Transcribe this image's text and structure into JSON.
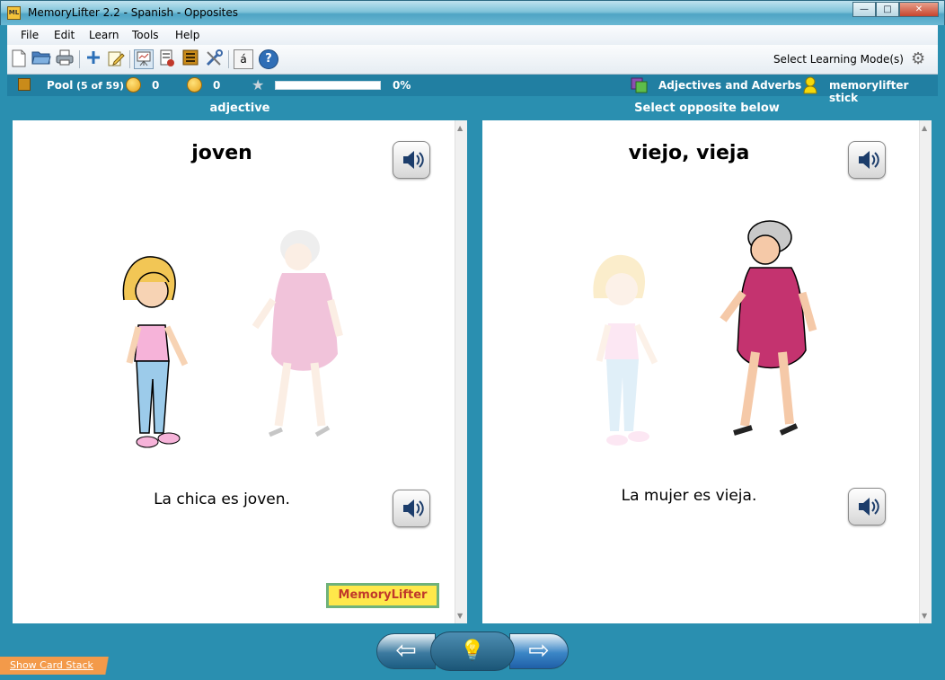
{
  "window": {
    "app_icon_text": "ML",
    "title": "MemoryLifter 2.2 - Spanish - Opposites",
    "minimize": "—",
    "maximize": "□",
    "close": "✕"
  },
  "menu": [
    "File",
    "Edit",
    "Learn",
    "Tools",
    "Help"
  ],
  "toolbar": {
    "icons": [
      "new-icon",
      "open-icon",
      "print-icon",
      "add-card-icon",
      "edit-icon",
      "presentation-icon",
      "card-stack-icon",
      "card-list-icon",
      "tools-icon",
      "accent-character-icon",
      "help-icon"
    ],
    "accent_glyph": "á",
    "help_glyph": "?",
    "mode_label": "Select Learning Mode(s)"
  },
  "status": {
    "pool_label": "Pool",
    "pool_count": "(5 of 59)",
    "correct_count": "0",
    "wrong_count": "0",
    "progress_percent": 0,
    "progress_text": "0%",
    "chapter": "Adjectives and Adverbs",
    "user": "memorylifter stick"
  },
  "question_panel": {
    "header": "adjective",
    "word": "joven",
    "sentence": "La chica es joven.",
    "logo_text": "MemoryLifter"
  },
  "answer_panel": {
    "header": "Select opposite below",
    "word": "viejo, vieja",
    "sentence": "La mujer es vieja."
  },
  "navigation": {
    "prev_glyph": "⇦",
    "hint_glyph": "💡",
    "next_glyph": "⇨"
  },
  "show_card_stack": "Show Card Stack",
  "colors": {
    "accent": "#217fa2",
    "window_bg": "#2a8fb0",
    "logo_yellow": "#ffe84a",
    "stack_tab": "#f39a4a"
  }
}
